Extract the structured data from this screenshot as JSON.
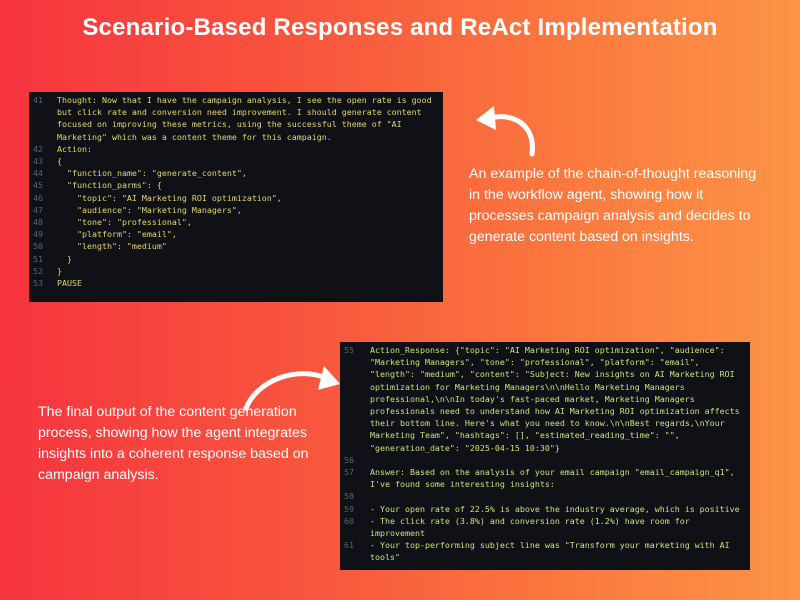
{
  "title": "Scenario-Based Responses and ReAct Implementation",
  "code_panel_1": {
    "lines": [
      {
        "n": "41",
        "t": "Thought: Now that I have the campaign analysis, I see the open rate is good but click rate and conversion need improvement. I should generate content focused on improving these metrics, using the successful theme of \"AI Marketing\" which was a content theme for this campaign."
      },
      {
        "n": "42",
        "t": "Action:"
      },
      {
        "n": "43",
        "t": "{"
      },
      {
        "n": "44",
        "t": "  \"function_name\": \"generate_content\","
      },
      {
        "n": "45",
        "t": "  \"function_parms\": {"
      },
      {
        "n": "46",
        "t": "    \"topic\": \"AI Marketing ROI optimization\","
      },
      {
        "n": "47",
        "t": "    \"audience\": \"Marketing Managers\","
      },
      {
        "n": "48",
        "t": "    \"tone\": \"professional\","
      },
      {
        "n": "49",
        "t": "    \"platform\": \"email\","
      },
      {
        "n": "50",
        "t": "    \"length\": \"medium\""
      },
      {
        "n": "51",
        "t": "  }"
      },
      {
        "n": "52",
        "t": "}"
      },
      {
        "n": "53",
        "t": "PAUSE"
      }
    ]
  },
  "code_panel_2": {
    "lines": [
      {
        "n": "55",
        "t": "Action_Response: {\"topic\": \"AI Marketing ROI optimization\", \"audience\": \"Marketing Managers\", \"tone\": \"professional\", \"platform\": \"email\", \"length\": \"medium\", \"content\": \"Subject: New insights on AI Marketing ROI optimization for Marketing Managers\\n\\nHello Marketing Managers professional,\\n\\nIn today's fast-paced market, Marketing Managers professionals need to understand how AI Marketing ROI optimization affects their bottom line. Here's what you need to know.\\n\\nBest regards,\\nYour Marketing Team\", \"hashtags\": [], \"estimated_reading_time\": \"\", \"generation_date\": \"2025-04-15 10:30\"}"
      },
      {
        "n": "56",
        "t": ""
      },
      {
        "n": "57",
        "t": "Answer: Based on the analysis of your email campaign \"email_campaign_q1\", I've found some interesting insights:"
      },
      {
        "n": "58",
        "t": ""
      },
      {
        "n": "59",
        "t": "- Your open rate of 22.5% is above the industry average, which is positive"
      },
      {
        "n": "60",
        "t": "- The click rate (3.8%) and conversion rate (1.2%) have room for improvement"
      },
      {
        "n": "61",
        "t": "- Your top-performing subject line was \"Transform your marketing with AI tools\""
      }
    ]
  },
  "captions": {
    "right": "An example of the chain-of-thought reasoning in the workflow agent, showing how it processes campaign analysis and decides to generate content based on insights.",
    "left": "The final output of the content generation process, showing how the agent integrates insights into a coherent response based on campaign analysis."
  },
  "icons": {
    "arrow_right_panel": "curved-arrow-left-icon",
    "arrow_left_panel": "curved-arrow-right-icon"
  },
  "colors": {
    "gradient_start": "#f6343f",
    "gradient_end": "#fd9447",
    "code_bg": "#0f1117",
    "code_text_1": "#e3d66a",
    "code_text_2": "#c9e37a"
  }
}
